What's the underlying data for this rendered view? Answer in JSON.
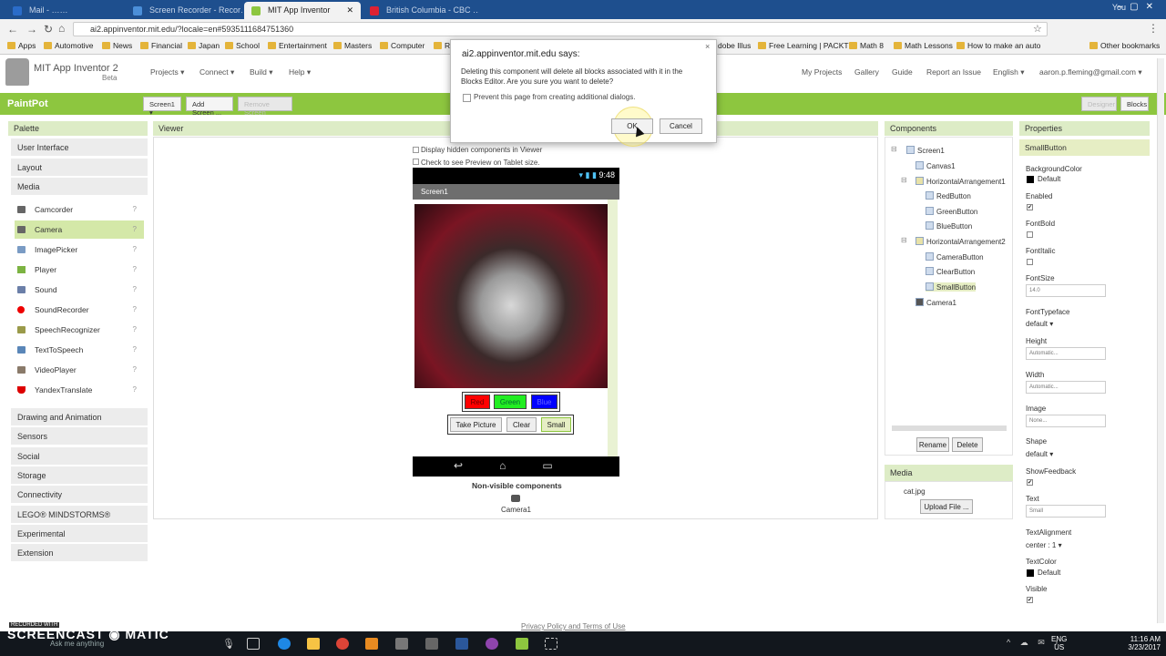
{
  "browser": {
    "tabs": [
      {
        "label": "Mail - ……",
        "active": false
      },
      {
        "label": "Screen Recorder - Recor…",
        "active": false
      },
      {
        "label": "MIT App Inventor",
        "active": true
      },
      {
        "label": "British Columbia - CBC …",
        "active": false
      }
    ],
    "user": "You",
    "url": "ai2.appinventor.mit.edu/?locale=en#5935111684751360",
    "bookmarks": [
      "Apps",
      "Automotive",
      "News",
      "Financial",
      "Japan",
      "School",
      "Entertainment",
      "Masters",
      "Computer",
      "R",
      "dobe Illus",
      "Free Learning | PACKT",
      "Math 8",
      "Math Lessons",
      "How to make an auto",
      "Other bookmarks"
    ]
  },
  "app": {
    "title": "MIT App Inventor 2",
    "beta": "Beta",
    "menus": [
      "Projects ▾",
      "Connect ▾",
      "Build ▾",
      "Help ▾"
    ],
    "right_menus": [
      "My Projects",
      "Gallery",
      "Guide",
      "Report an Issue",
      "English ▾",
      "aaron.p.fleming@gmail.com ▾"
    ]
  },
  "toolbar": {
    "project": "PaintPot",
    "screen_btn": "Screen1 ▾",
    "add_screen": "Add Screen ...",
    "remove_screen": "Remove Screen",
    "designer": "Designer",
    "blocks": "Blocks"
  },
  "palette": {
    "title": "Palette",
    "categories_top": [
      "User Interface",
      "Layout",
      "Media"
    ],
    "media_items": [
      "Camcorder",
      "Camera",
      "ImagePicker",
      "Player",
      "Sound",
      "SoundRecorder",
      "SpeechRecognizer",
      "TextToSpeech",
      "VideoPlayer",
      "YandexTranslate"
    ],
    "selected": "Camera",
    "categories_bottom": [
      "Drawing and Animation",
      "Sensors",
      "Social",
      "Storage",
      "Connectivity",
      "LEGO® MINDSTORMS®",
      "Experimental",
      "Extension"
    ],
    "help": "?"
  },
  "viewer": {
    "title": "Viewer",
    "hidden_label": "Display hidden components in Viewer",
    "tablet_label": "Check to see Preview on Tablet size.",
    "clock": "9:48",
    "screen_title": "Screen1",
    "row1": [
      "Red",
      "Green",
      "Blue"
    ],
    "row2": [
      "Take Picture",
      "Clear",
      "Small"
    ],
    "nonvisible_title": "Non-visible components",
    "nonvisible_item": "Camera1"
  },
  "components": {
    "title": "Components",
    "tree": [
      "Screen1",
      "Canvas1",
      "HorizontalArrangement1",
      "RedButton",
      "GreenButton",
      "BlueButton",
      "HorizontalArrangement2",
      "CameraButton",
      "ClearButton",
      "SmallButton",
      "Camera1"
    ],
    "selected": "SmallButton",
    "rename": "Rename",
    "delete": "Delete"
  },
  "media": {
    "title": "Media",
    "file": "cat.jpg",
    "upload": "Upload File ..."
  },
  "properties": {
    "title": "Properties",
    "component": "SmallButton",
    "background_color_label": "BackgroundColor",
    "background_color_value": "Default",
    "enabled_label": "Enabled",
    "fontbold_label": "FontBold",
    "fontitalic_label": "FontItalic",
    "fontsize_label": "FontSize",
    "fontsize_value": "14.0",
    "fonttypeface_label": "FontTypeface",
    "fonttypeface_value": "default ▾",
    "height_label": "Height",
    "height_value": "Automatic...",
    "width_label": "Width",
    "width_value": "Automatic...",
    "image_label": "Image",
    "image_value": "None...",
    "shape_label": "Shape",
    "shape_value": "default ▾",
    "showfeedback_label": "ShowFeedback",
    "text_label": "Text",
    "text_value": "Small",
    "textalignment_label": "TextAlignment",
    "textalignment_value": "center : 1 ▾",
    "textcolor_label": "TextColor",
    "textcolor_value": "Default",
    "visible_label": "Visible",
    "check": "✔"
  },
  "dialog": {
    "title": "ai2.appinventor.mit.edu says:",
    "message": "Deleting this component will delete all blocks associated with it in the Blocks Editor. Are you sure you want to delete?",
    "prevent": "Prevent this page from creating additional dialogs.",
    "ok": "OK",
    "cancel": "Cancel",
    "close": "×"
  },
  "footer": {
    "privacy": "Privacy Policy and Terms of Use"
  },
  "taskbar": {
    "search": "Ask me anything",
    "lang": "ENG",
    "region": "US",
    "time": "11:16 AM",
    "date": "3/23/2017",
    "watermark": "SCREENCAST ◉ MATIC",
    "recorded": "RECORDED WITH"
  },
  "colors": {
    "accent_green": "#8dc63f",
    "red": "#ff0000",
    "green": "#00ff00",
    "blue": "#0000ff"
  }
}
